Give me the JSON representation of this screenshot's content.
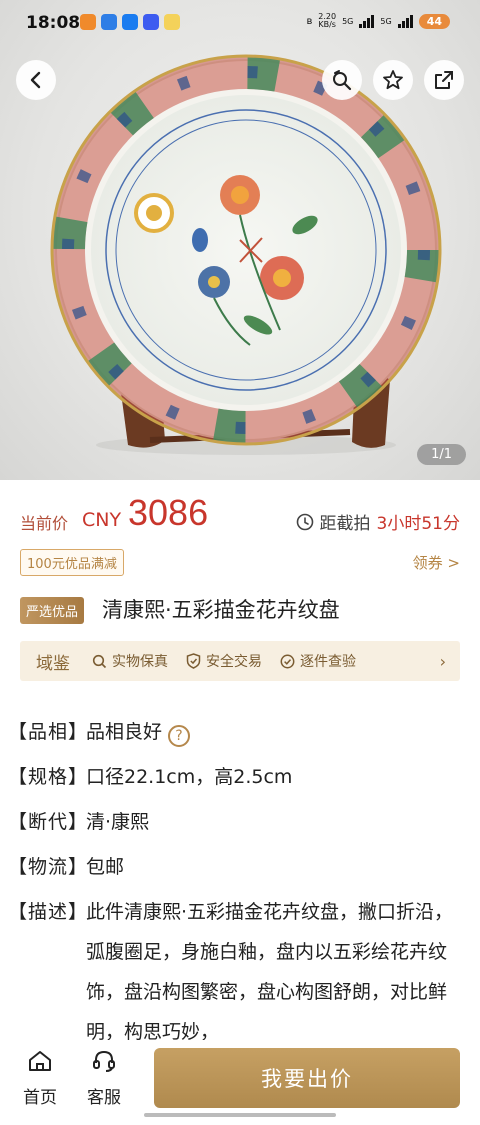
{
  "status_bar": {
    "time": "18:08",
    "net_speed_value": "2.20",
    "net_speed_unit": "KB/s",
    "network_1": "5G",
    "network_2": "5G",
    "battery": "44"
  },
  "gallery": {
    "counter": "1/1",
    "icons": {
      "back": "chevron-left-icon",
      "similar": "image-search-icon",
      "favorite": "star-icon",
      "share": "share-icon"
    }
  },
  "price": {
    "label": "当前价",
    "currency": "CNY",
    "value": "3086",
    "countdown_label": "距截拍",
    "countdown_value": "3小时51分"
  },
  "coupon": {
    "tag": "100元优品满减",
    "link": "领券 >"
  },
  "title": {
    "badge": "严选优品",
    "text": "清康熙·五彩描金花卉纹盘"
  },
  "assurance": {
    "brand": "域鉴",
    "items": [
      "实物保真",
      "安全交易",
      "逐件查验"
    ]
  },
  "specs": [
    {
      "key": "【品相】",
      "value": "品相良好"
    },
    {
      "key": "【规格】",
      "value": "口径22.1cm，高2.5cm"
    },
    {
      "key": "【断代】",
      "value": "清·康熙"
    },
    {
      "key": "【物流】",
      "value": "包邮"
    },
    {
      "key": "【描述】",
      "value": "此件清康熙·五彩描金花卉纹盘，撇口折沿，弧腹圈足，身施白釉，盘内以五彩绘花卉纹饰，盘沿构图繁密，盘心构图舒朗，对比鲜明，构思巧妙，"
    }
  ],
  "bottom_bar": {
    "home": "首页",
    "service": "客服",
    "bid": "我要出价"
  },
  "colors": {
    "price_red": "#c8362c",
    "gold": "#b08a4e",
    "assure_bg": "#f7efe1"
  }
}
